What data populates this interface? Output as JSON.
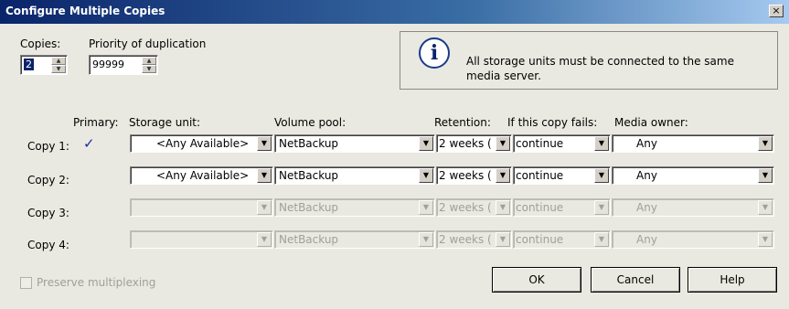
{
  "window": {
    "title": "Configure Multiple Copies",
    "close_glyph": "×"
  },
  "copies": {
    "label": "Copies:",
    "value": "2"
  },
  "priority": {
    "label": "Priority of duplication",
    "value": "99999"
  },
  "info": {
    "icon": "info-icon",
    "glyph": "i",
    "text": "All storage units must be connected to the same media server."
  },
  "headers": {
    "primary": "Primary:",
    "storage_unit": "Storage unit:",
    "volume_pool": "Volume pool:",
    "retention": "Retention:",
    "if_fails": "If this copy fails:",
    "media_owner": "Media owner:"
  },
  "rows": [
    {
      "label": "Copy 1:",
      "primary": true,
      "storage_unit": "<Any Available>",
      "volume_pool": "NetBackup",
      "retention": "2 weeks (",
      "if_fails": "continue",
      "media_owner": "Any",
      "enabled": true
    },
    {
      "label": "Copy 2:",
      "primary": false,
      "storage_unit": "<Any Available>",
      "volume_pool": "NetBackup",
      "retention": "2 weeks (",
      "if_fails": "continue",
      "media_owner": "Any",
      "enabled": true
    },
    {
      "label": "Copy 3:",
      "primary": false,
      "storage_unit": "",
      "volume_pool": "NetBackup",
      "retention": "2 weeks (",
      "if_fails": "continue",
      "media_owner": "Any",
      "enabled": false
    },
    {
      "label": "Copy 4:",
      "primary": false,
      "storage_unit": "",
      "volume_pool": "NetBackup",
      "retention": "2 weeks (",
      "if_fails": "continue",
      "media_owner": "Any",
      "enabled": false
    }
  ],
  "checkmark_glyph": "✓",
  "preserve": {
    "label": "Preserve multiplexing",
    "checked": false,
    "enabled": false
  },
  "buttons": {
    "ok": "OK",
    "cancel": "Cancel",
    "help": "Help"
  },
  "colors": {
    "title_bar": "#0a246a",
    "face": "#e9e9e1",
    "selection": "#0a246a"
  }
}
